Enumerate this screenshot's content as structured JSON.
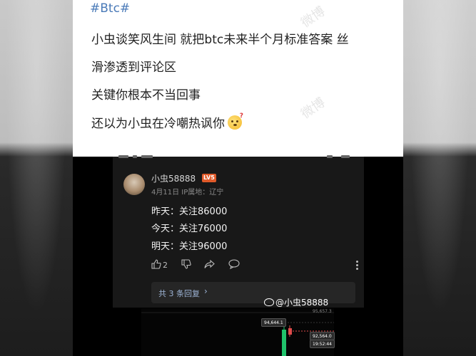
{
  "post": {
    "hashtag": "#Btc#",
    "lines": [
      "小虫谈笑风生间 就把btc未来半个月标准答案 丝",
      "滑渗透到评论区",
      "关键你根本不当回事",
      "还以为小虫在冷嘲热讽你"
    ],
    "emoji": "thinking-face-icon"
  },
  "watermark": "微博",
  "comment": {
    "username": "小虫58888",
    "level_badge": "LV5",
    "meta": "4月11日 IP属地：辽宁",
    "lines": [
      "昨天：关注86000",
      "今天：关注76000",
      "明天：关注96000"
    ],
    "like_count": "2",
    "replies_label": "共 3 条回复",
    "replies_chevron": "›"
  },
  "credit": {
    "handle": "@小虫58888"
  },
  "chart": {
    "top_tick": "95,657.3",
    "high_label": "94,644.1",
    "price_label": "92,564.0",
    "time_label": "19:52:44",
    "colors": {
      "up": "#20c36b",
      "down": "#e04b4b",
      "bg": "#050505"
    }
  },
  "colors": {
    "hashtag": "#4a7ab8",
    "link": "#9db4d6",
    "badge": "#e05a2a"
  }
}
